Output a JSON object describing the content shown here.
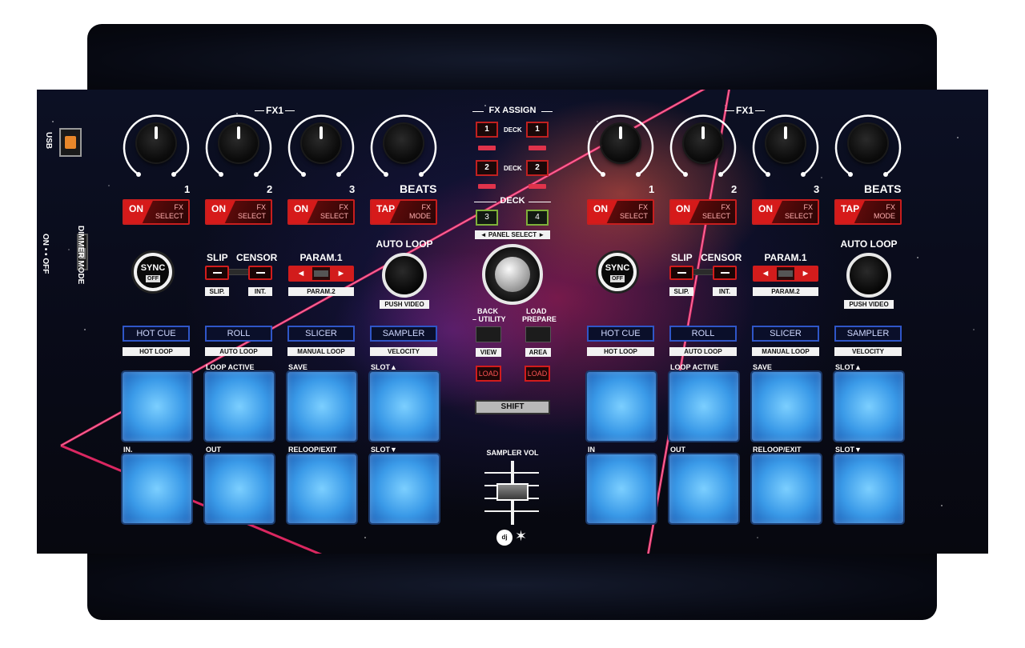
{
  "colors": {
    "accent_red": "#d21c1c",
    "pad_blue": "#3a9ae8",
    "mode_blue": "#2f56c8",
    "usb_orange": "#e8872a",
    "neon_pink": "#ff2d6f"
  },
  "left_panel": {
    "usb_label": "USB",
    "dimmer_mode": "DIMMER MODE",
    "on_off": "ON • • OFF"
  },
  "fx_header": "FX1",
  "knob_numbers": [
    "1",
    "2",
    "3"
  ],
  "beats": "BEATS",
  "fx_buttons": [
    {
      "main": "ON",
      "sub1": "FX",
      "sub2": "SELECT"
    },
    {
      "main": "ON",
      "sub1": "FX",
      "sub2": "SELECT"
    },
    {
      "main": "ON",
      "sub1": "FX",
      "sub2": "SELECT"
    },
    {
      "main": "TAP",
      "sub1": "FX",
      "sub2": "MODE"
    }
  ],
  "sync": {
    "label": "SYNC",
    "state": "OFF"
  },
  "slip": "SLIP",
  "censor": "CENSOR",
  "slip_tag": "SLIP.",
  "int_tag": "INT.",
  "param1": "PARAM.1",
  "param2": "PARAM.2",
  "param_left": "◄",
  "param_right": "►",
  "auto_loop": "AUTO LOOP",
  "push_video": "PUSH VIDEO",
  "modes": [
    "HOT CUE",
    "ROLL",
    "SLICER",
    "SAMPLER"
  ],
  "mode_tags": [
    "HOT LOOP",
    "AUTO LOOP",
    "MANUAL LOOP",
    "VELOCITY"
  ],
  "pad_top_labels": [
    "",
    "LOOP ACTIVE",
    "SAVE",
    "SLOT▲"
  ],
  "pad_bottom_labels": [
    "IN.",
    "OUT",
    "RELOOP/EXIT",
    "SLOT▼"
  ],
  "pad_bottom_labels_right": [
    "IN",
    "OUT",
    "RELOOP/EXIT",
    "SLOT▼"
  ],
  "center": {
    "fx_assign": "FX ASSIGN",
    "deck_small": "DECK",
    "assign_buttons": [
      "1",
      "1",
      "2",
      "2"
    ],
    "deck_header": "DECK",
    "deck_buttons": [
      "3",
      "4"
    ],
    "panel_select": "◄ PANEL SELECT ►",
    "back": "BACK",
    "utility": "– UTILITY",
    "load_l": "LOAD",
    "prepare": "PREPARE",
    "view": "VIEW",
    "area": "AREA",
    "load_btn": "LOAD",
    "shift": "SHIFT",
    "sampler_vol": "SAMPLER VOL",
    "logo": "dj"
  }
}
